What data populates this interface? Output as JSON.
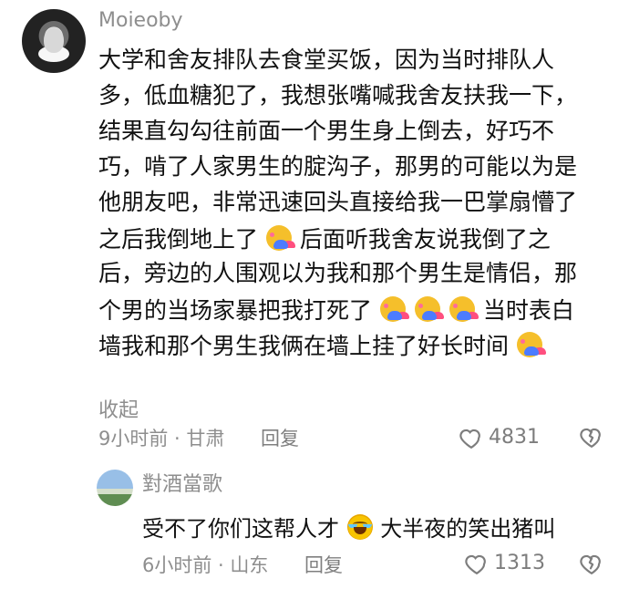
{
  "comment": {
    "username": "Moieoby",
    "lines": [
      {
        "text": "大学和舍友排队去食堂买饭，因为当时排队人"
      },
      {
        "text": "多，低血糖犯了，我想张嘴喊我舍友扶我一下，"
      },
      {
        "text": "结果直勾勾往前面一个男生身上倒去，好巧不"
      },
      {
        "text": "巧，啃了人家男生的腚沟子，那男的可能以为是"
      },
      {
        "text": "他朋友吧，非常迅速回头直接给我一巴掌扇懵了"
      },
      {
        "before": "之后我倒地上了",
        "after": "后面听我舍友说我倒了之"
      },
      {
        "text": "后，旁边的人围观以为我和那个男生是情侣，那"
      },
      {
        "before": "个男的当场家暴把我打死了",
        "after": "当时表白"
      },
      {
        "before": "墙我和那个男生我俩在墙上挂了好长时间",
        "after": ""
      }
    ],
    "collapse_label": "收起",
    "meta": "9小时前 · 甘肃",
    "reply_label": "回复",
    "like_count": "4831"
  },
  "reply": {
    "username": "對酒當歌",
    "text_before": "受不了你们这帮人才",
    "text_after": "大半夜的笑出猪叫",
    "meta": "6小时前 · 山东",
    "reply_label": "回复",
    "like_count": "1313"
  },
  "colors": {
    "text": "#111111",
    "secondary": "#8e8e8e",
    "background": "#ffffff"
  }
}
